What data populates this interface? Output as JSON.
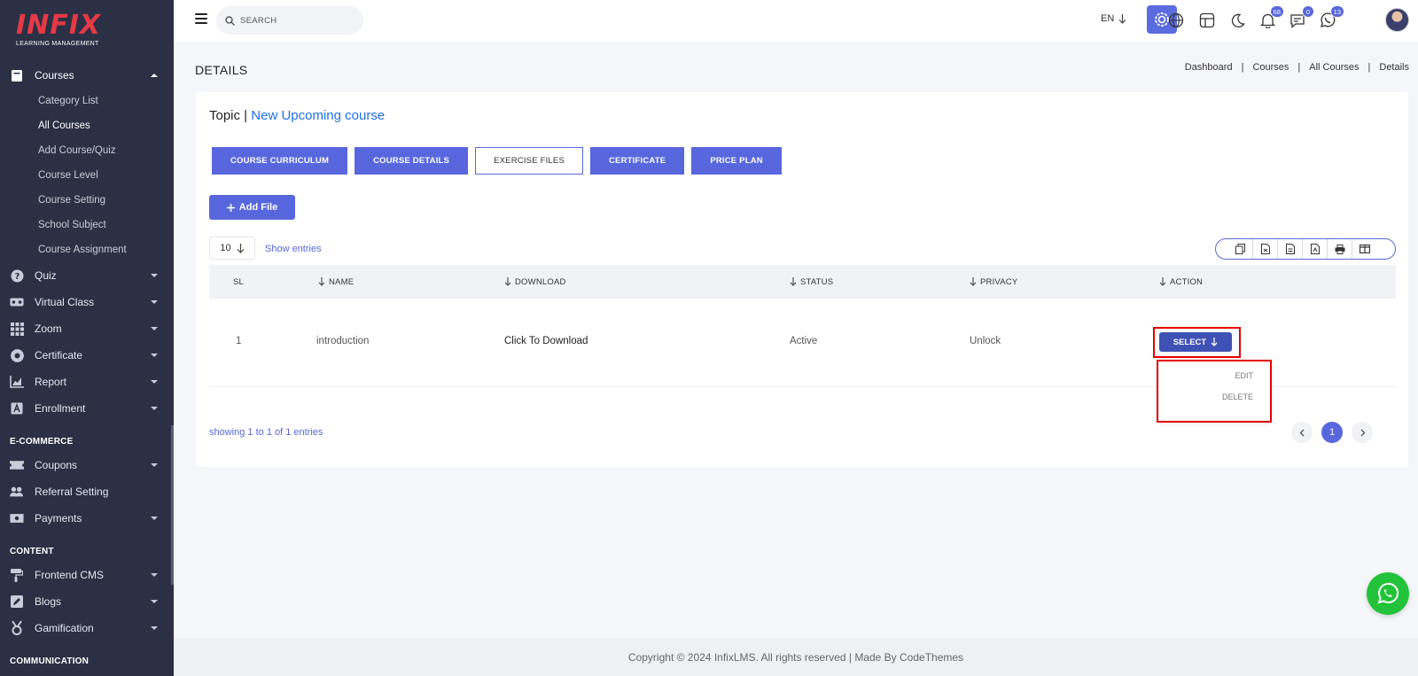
{
  "brand": {
    "logo_text": "INFIX",
    "logo_tagline": "LEARNING MANAGEMENT",
    "accent_color": "#5867dd",
    "logo_color": "#e63946"
  },
  "sidebar": {
    "courses": {
      "label": "Courses",
      "children": [
        "Category List",
        "All Courses",
        "Add Course/Quiz",
        "Course Level",
        "Course Setting",
        "School Subject",
        "Course Assignment"
      ]
    },
    "items": [
      {
        "label": "Quiz",
        "icon": "question-icon"
      },
      {
        "label": "Virtual Class",
        "icon": "vr-icon"
      },
      {
        "label": "Zoom",
        "icon": "grid-icon"
      },
      {
        "label": "Certificate",
        "icon": "badge-icon"
      },
      {
        "label": "Report",
        "icon": "chart-icon"
      },
      {
        "label": "Enrollment",
        "icon": "enrollment-icon"
      }
    ],
    "section_ecommerce": "E-COMMERCE",
    "ecommerce_items": [
      {
        "label": "Coupons",
        "icon": "ticket-icon"
      },
      {
        "label": "Referral Setting",
        "icon": "users-icon"
      },
      {
        "label": "Payments",
        "icon": "money-icon"
      }
    ],
    "section_content": "CONTENT",
    "content_items": [
      {
        "label": "Frontend CMS",
        "icon": "paint-roller-icon"
      },
      {
        "label": "Blogs",
        "icon": "edit-icon"
      },
      {
        "label": "Gamification",
        "icon": "medal-icon"
      }
    ],
    "section_communication": "COMMUNICATION"
  },
  "topbar": {
    "search_placeholder": "SEARCH",
    "language": "EN",
    "badges": {
      "notifications": "68",
      "messages": "0",
      "whatsapp": "13"
    }
  },
  "page": {
    "title": "DETAILS",
    "breadcrumb": [
      "Dashboard",
      "Courses",
      "All Courses",
      "Details"
    ]
  },
  "card": {
    "topic_label": "Topic |",
    "topic_name": "New Upcoming course",
    "tabs": [
      "COURSE CURRICULUM",
      "COURSE DETAILS",
      "EXERCISE FILES",
      "CERTIFICATE",
      "PRICE PLAN"
    ],
    "add_file_label": "Add File",
    "entries_value": "10",
    "entries_label": "Show entries",
    "export_icons": [
      "copy-icon",
      "csv-icon",
      "excel-icon",
      "pdf-icon",
      "print-icon",
      "columns-icon"
    ]
  },
  "table": {
    "headers": [
      "SL",
      "NAME",
      "DOWNLOAD",
      "STATUS",
      "PRIVACY",
      "ACTION"
    ],
    "rows": [
      {
        "sl": "1",
        "name": "introduction",
        "download": "Click To Download",
        "status": "Active",
        "privacy": "Unlock",
        "action": "SELECT"
      }
    ],
    "dropdown": [
      "EDIT",
      "DELETE"
    ],
    "showing": "showing 1 to 1 of 1 entries",
    "pagination": {
      "current": "1"
    }
  },
  "footer": {
    "text": "Copyright © 2024 InfixLMS. All rights reserved | Made By CodeThemes"
  }
}
